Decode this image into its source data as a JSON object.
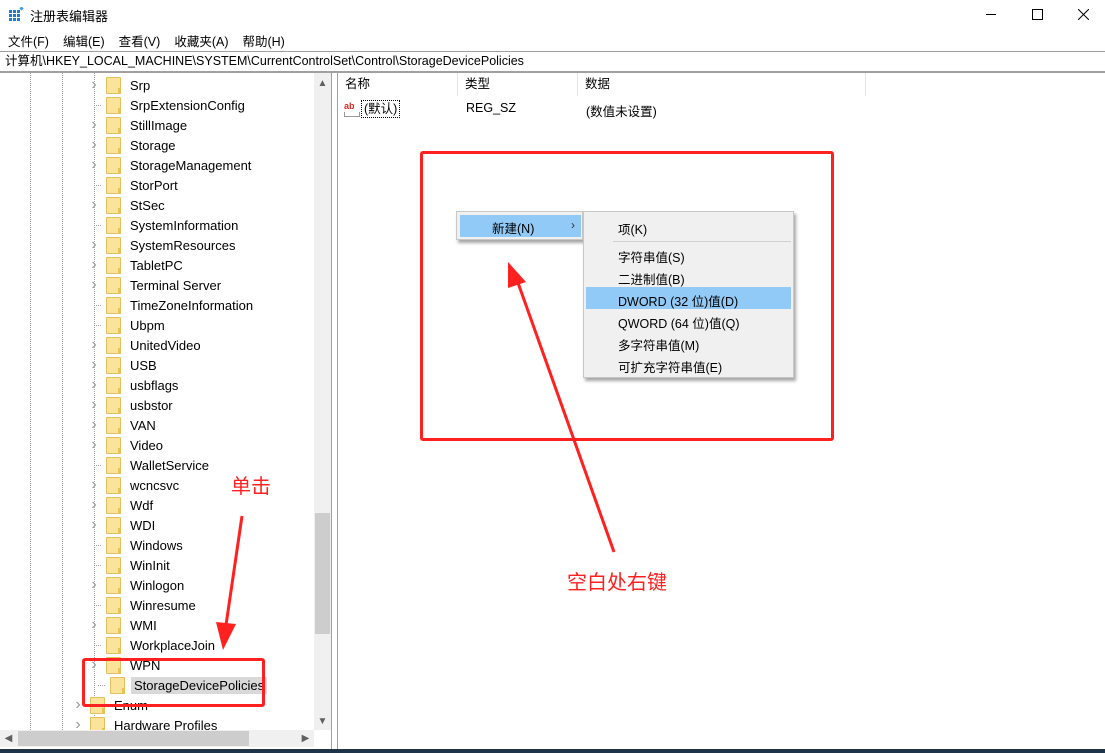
{
  "window": {
    "title": "注册表编辑器",
    "controls": {
      "minimize": "minimize",
      "maximize": "maximize",
      "close": "close"
    }
  },
  "menubar": {
    "items": [
      {
        "label": "文件(F)"
      },
      {
        "label": "编辑(E)"
      },
      {
        "label": "查看(V)"
      },
      {
        "label": "收藏夹(A)"
      },
      {
        "label": "帮助(H)"
      }
    ]
  },
  "address": {
    "path": "计算机\\HKEY_LOCAL_MACHINE\\SYSTEM\\CurrentControlSet\\Control\\StorageDevicePolicies"
  },
  "tree": {
    "items": [
      {
        "label": "Srp",
        "expandable": true
      },
      {
        "label": "SrpExtensionConfig",
        "expandable": false
      },
      {
        "label": "StillImage",
        "expandable": true
      },
      {
        "label": "Storage",
        "expandable": true
      },
      {
        "label": "StorageManagement",
        "expandable": true
      },
      {
        "label": "StorPort",
        "expandable": false
      },
      {
        "label": "StSec",
        "expandable": true
      },
      {
        "label": "SystemInformation",
        "expandable": false
      },
      {
        "label": "SystemResources",
        "expandable": true
      },
      {
        "label": "TabletPC",
        "expandable": true
      },
      {
        "label": "Terminal Server",
        "expandable": true
      },
      {
        "label": "TimeZoneInformation",
        "expandable": false
      },
      {
        "label": "Ubpm",
        "expandable": false
      },
      {
        "label": "UnitedVideo",
        "expandable": true
      },
      {
        "label": "USB",
        "expandable": true
      },
      {
        "label": "usbflags",
        "expandable": true
      },
      {
        "label": "usbstor",
        "expandable": true
      },
      {
        "label": "VAN",
        "expandable": true
      },
      {
        "label": "Video",
        "expandable": true
      },
      {
        "label": "WalletService",
        "expandable": false
      },
      {
        "label": "wcncsvc",
        "expandable": true
      },
      {
        "label": "Wdf",
        "expandable": true
      },
      {
        "label": "WDI",
        "expandable": true
      },
      {
        "label": "Windows",
        "expandable": false
      },
      {
        "label": "WinInit",
        "expandable": false
      },
      {
        "label": "Winlogon",
        "expandable": true
      },
      {
        "label": "Winresume",
        "expandable": false
      },
      {
        "label": "WMI",
        "expandable": true
      },
      {
        "label": "WorkplaceJoin",
        "expandable": false
      },
      {
        "label": "WPN",
        "expandable": true
      },
      {
        "label": "StorageDevicePolicies",
        "expandable": false,
        "selected": true
      }
    ],
    "parent_items": [
      {
        "label": "Enum",
        "expandable": true
      },
      {
        "label": "Hardware Profiles",
        "expandable": true
      }
    ]
  },
  "list": {
    "columns": {
      "name": "名称",
      "type": "类型",
      "data": "数据"
    },
    "rows": [
      {
        "icon": "ab",
        "name": "(默认)",
        "type": "REG_SZ",
        "data": "(数值未设置)"
      }
    ]
  },
  "context_menu": {
    "new_label": "新建(N)",
    "arrow": "›",
    "submenu": [
      {
        "label": "项(K)"
      },
      {
        "label": "字符串值(S)"
      },
      {
        "label": "二进制值(B)"
      },
      {
        "label": "DWORD (32 位)值(D)",
        "highlighted": true
      },
      {
        "label": "QWORD (64 位)值(Q)"
      },
      {
        "label": "多字符串值(M)"
      },
      {
        "label": "可扩充字符串值(E)"
      }
    ]
  },
  "annotations": {
    "click_note": "单击",
    "right_click_note": "空白处右键",
    "color": "#ff2020"
  },
  "colors": {
    "menu_highlight": "#91c9f7",
    "selection": "#d9d9d9",
    "folder": "#fbe39a"
  }
}
